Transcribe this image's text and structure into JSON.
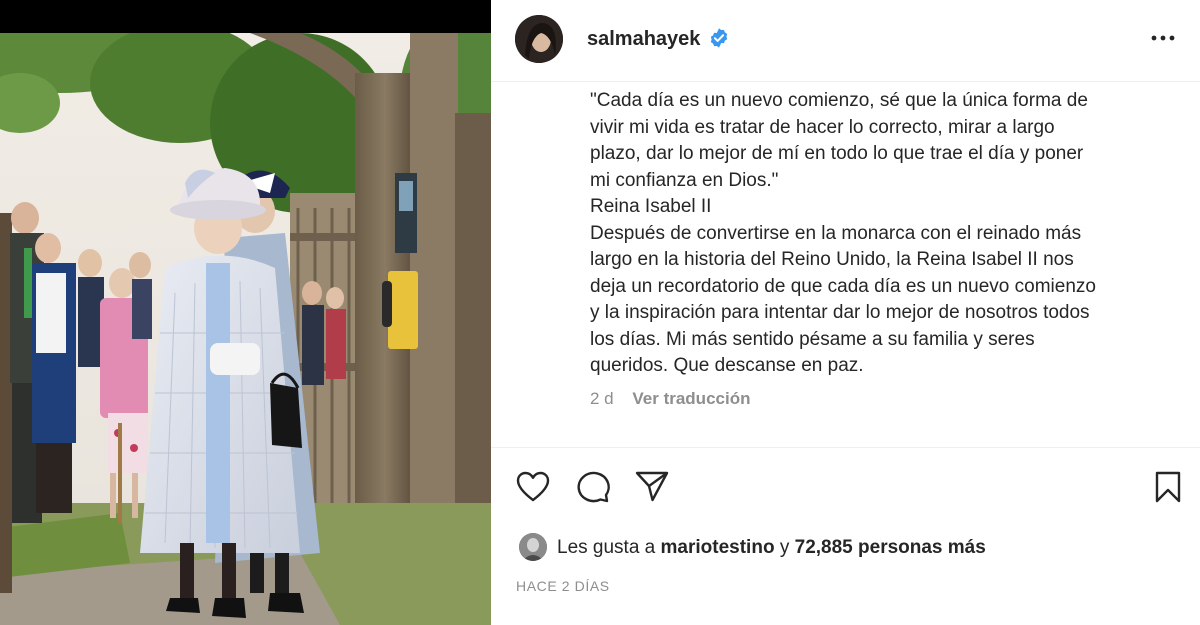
{
  "post": {
    "username": "salmahayek",
    "verified": true,
    "caption_lines": [
      "\"Cada día es un nuevo comienzo, sé que la única forma de",
      "vivir mi vida es tratar de hacer lo correcto, mirar a largo",
      "plazo, dar lo mejor de mí en todo lo que trae el día y poner",
      "mi confianza en Dios.\"",
      "Reina Isabel II",
      "Después de convertirse en la monarca con el reinado más",
      "largo en la historia del Reino Unido, la Reina Isabel II nos",
      "deja un recordatorio de que cada día es un nuevo comienzo",
      "y la inspiración para intentar dar lo mejor de nosotros todos",
      "los días. Mi más sentido pésame a su familia y seres",
      "queridos. Que descanse en paz."
    ],
    "age": "2 d",
    "translate_label": "Ver traducción",
    "likes_prefix": "Les gusta a",
    "liked_by": "mariotestino",
    "likes_connector": "y",
    "likes_count": "72,885 personas más",
    "timestamp": "HACE 2 DÍAS"
  },
  "icons": {
    "verified": "verified-badge-icon",
    "more": "more-options-icon",
    "like": "heart-icon",
    "comment": "comment-icon",
    "share": "paper-plane-icon",
    "save": "bookmark-icon"
  },
  "colors": {
    "verified_blue": "#3897f0",
    "text": "#262626",
    "muted": "#8e8e8e",
    "divider": "#efefef"
  }
}
